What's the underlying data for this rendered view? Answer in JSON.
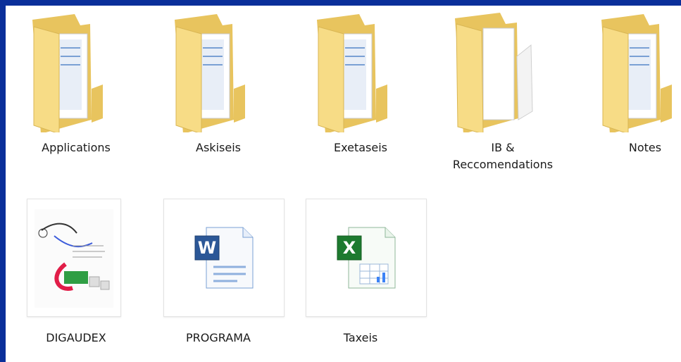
{
  "items": [
    {
      "label": "Applications",
      "type": "folder",
      "icon": "folder-icon"
    },
    {
      "label": "Askiseis",
      "type": "folder",
      "icon": "folder-icon"
    },
    {
      "label": "Exetaseis",
      "type": "folder",
      "icon": "folder-icon"
    },
    {
      "label": "IB &\nReccomendations",
      "type": "folder-open",
      "icon": "folder-open-icon"
    },
    {
      "label": "Notes",
      "type": "folder",
      "icon": "folder-icon"
    },
    {
      "label": "DIGAUDEX",
      "type": "image",
      "icon": "diagram-thumbnail-icon"
    },
    {
      "label": "PROGRAMA",
      "type": "word",
      "icon": "word-document-icon"
    },
    {
      "label": "Taxeis",
      "type": "excel",
      "icon": "excel-document-icon"
    }
  ],
  "colors": {
    "background": "#0a2f9a",
    "pane": "#ffffff",
    "folder": "#f4d77a",
    "word": "#2b5797",
    "excel": "#1d7a2f"
  }
}
